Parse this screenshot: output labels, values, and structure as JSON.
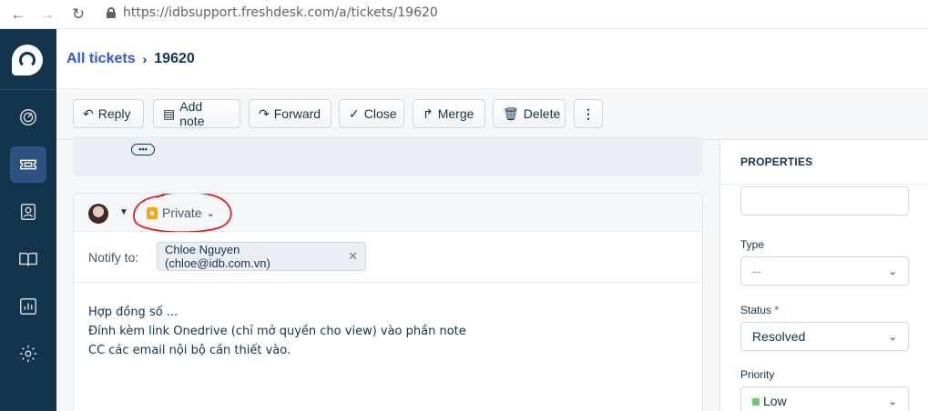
{
  "browser": {
    "url": "https://idbsupport.freshdesk.com/a/tickets/19620"
  },
  "breadcrumb": {
    "parent": "All tickets",
    "current": "19620"
  },
  "toolbar": {
    "reply": "Reply",
    "add_note": "Add note",
    "forward": "Forward",
    "close": "Close",
    "merge": "Merge",
    "delete": "Delete"
  },
  "editor": {
    "visibility": "Private",
    "notify_label": "Notify to:",
    "notify_chip": "Chloe Nguyen (chloe@idb.com.vn)",
    "body_lines": [
      "Hợp đồng số ...",
      "Đính kèm link Onedrive (chỉ mở quyền cho view) vào phần note",
      "CC các email nội bộ cần thiết vào."
    ]
  },
  "properties": {
    "title": "PROPERTIES",
    "type_label": "Type",
    "type_value": "--",
    "status_label": "Status",
    "status_required": "*",
    "status_value": "Resolved",
    "priority_label": "Priority",
    "priority_value": "Low",
    "priority_color": "#6fca6f"
  },
  "colors": {
    "sidebar": "#12344d",
    "accent": "#2c5cc5",
    "annotation": "#e02020"
  },
  "icons": [
    "back-icon",
    "forward-icon",
    "reload-icon",
    "lock-icon",
    "dashboard-icon",
    "tickets-icon",
    "contacts-icon",
    "solutions-icon",
    "reports-icon",
    "admin-icon"
  ]
}
